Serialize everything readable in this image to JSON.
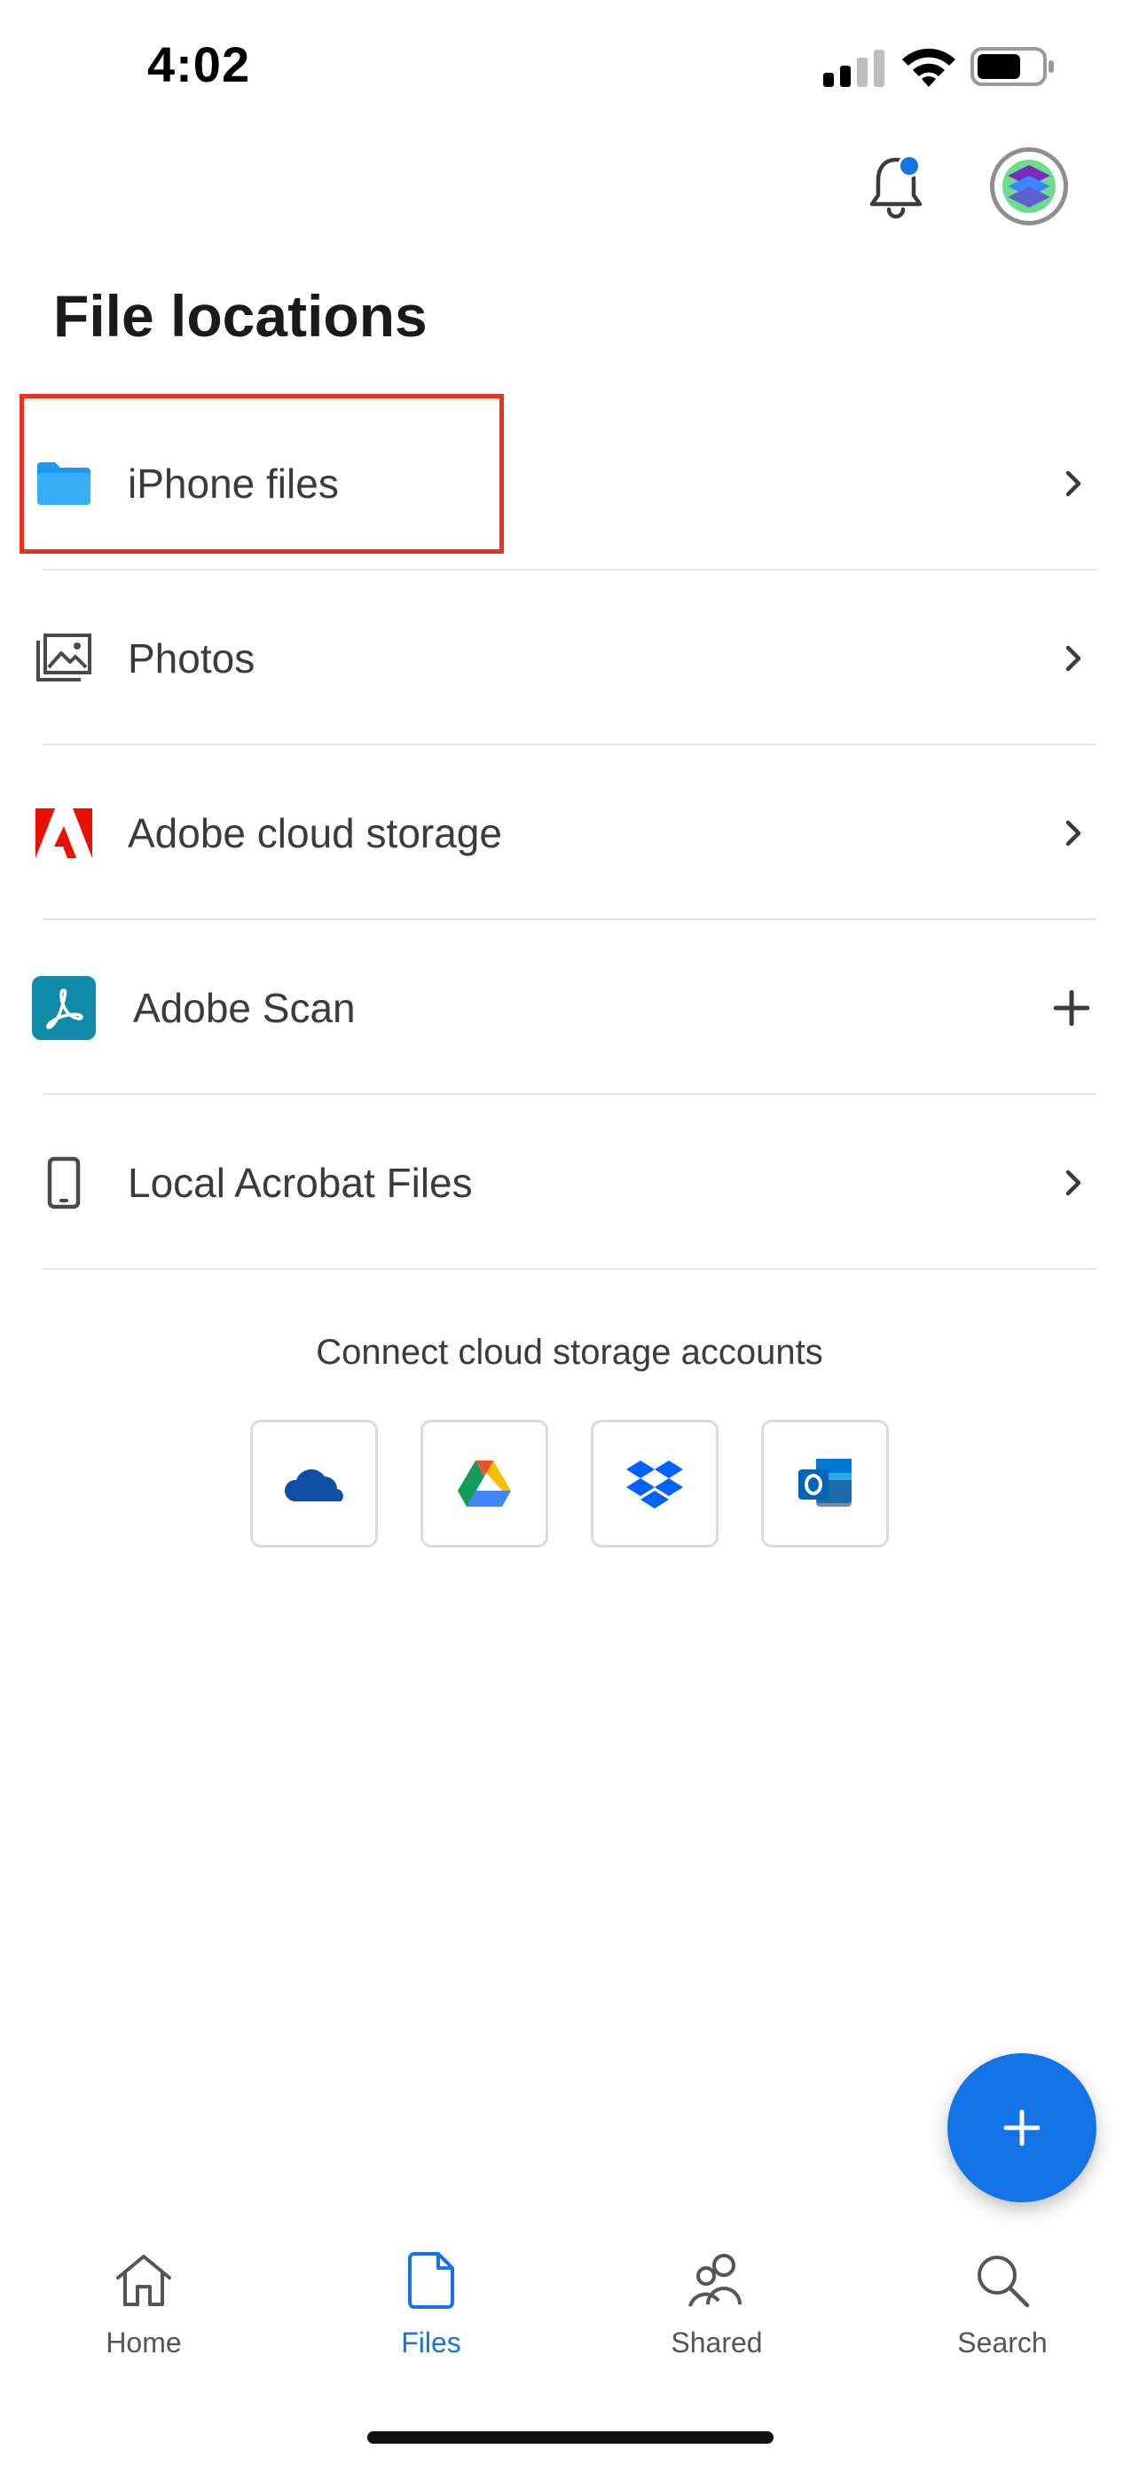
{
  "status_bar": {
    "time": "4:02"
  },
  "header": {
    "title": "File locations"
  },
  "locations": [
    {
      "label": "iPhone files",
      "icon": "folder-icon",
      "action": "chevron"
    },
    {
      "label": "Photos",
      "icon": "photos-icon",
      "action": "chevron"
    },
    {
      "label": "Adobe cloud storage",
      "icon": "adobe-logo-icon",
      "action": "chevron"
    },
    {
      "label": "Adobe Scan",
      "icon": "adobe-scan-icon",
      "action": "plus"
    },
    {
      "label": "Local Acrobat Files",
      "icon": "phone-device-icon",
      "action": "chevron"
    }
  ],
  "connect": {
    "title": "Connect cloud storage accounts",
    "services": [
      "onedrive-icon",
      "google-drive-icon",
      "dropbox-icon",
      "outlook-icon"
    ]
  },
  "nav": {
    "items": [
      {
        "label": "Home",
        "icon": "home-icon",
        "active": false
      },
      {
        "label": "Files",
        "icon": "file-icon",
        "active": true
      },
      {
        "label": "Shared",
        "icon": "shared-users-icon",
        "active": false
      },
      {
        "label": "Search",
        "icon": "search-icon",
        "active": false
      }
    ]
  },
  "colors": {
    "accent": "#1473e6",
    "highlight": "#e8321f",
    "adobe_red": "#eb1000",
    "scan_teal": "#0f8aa8"
  }
}
